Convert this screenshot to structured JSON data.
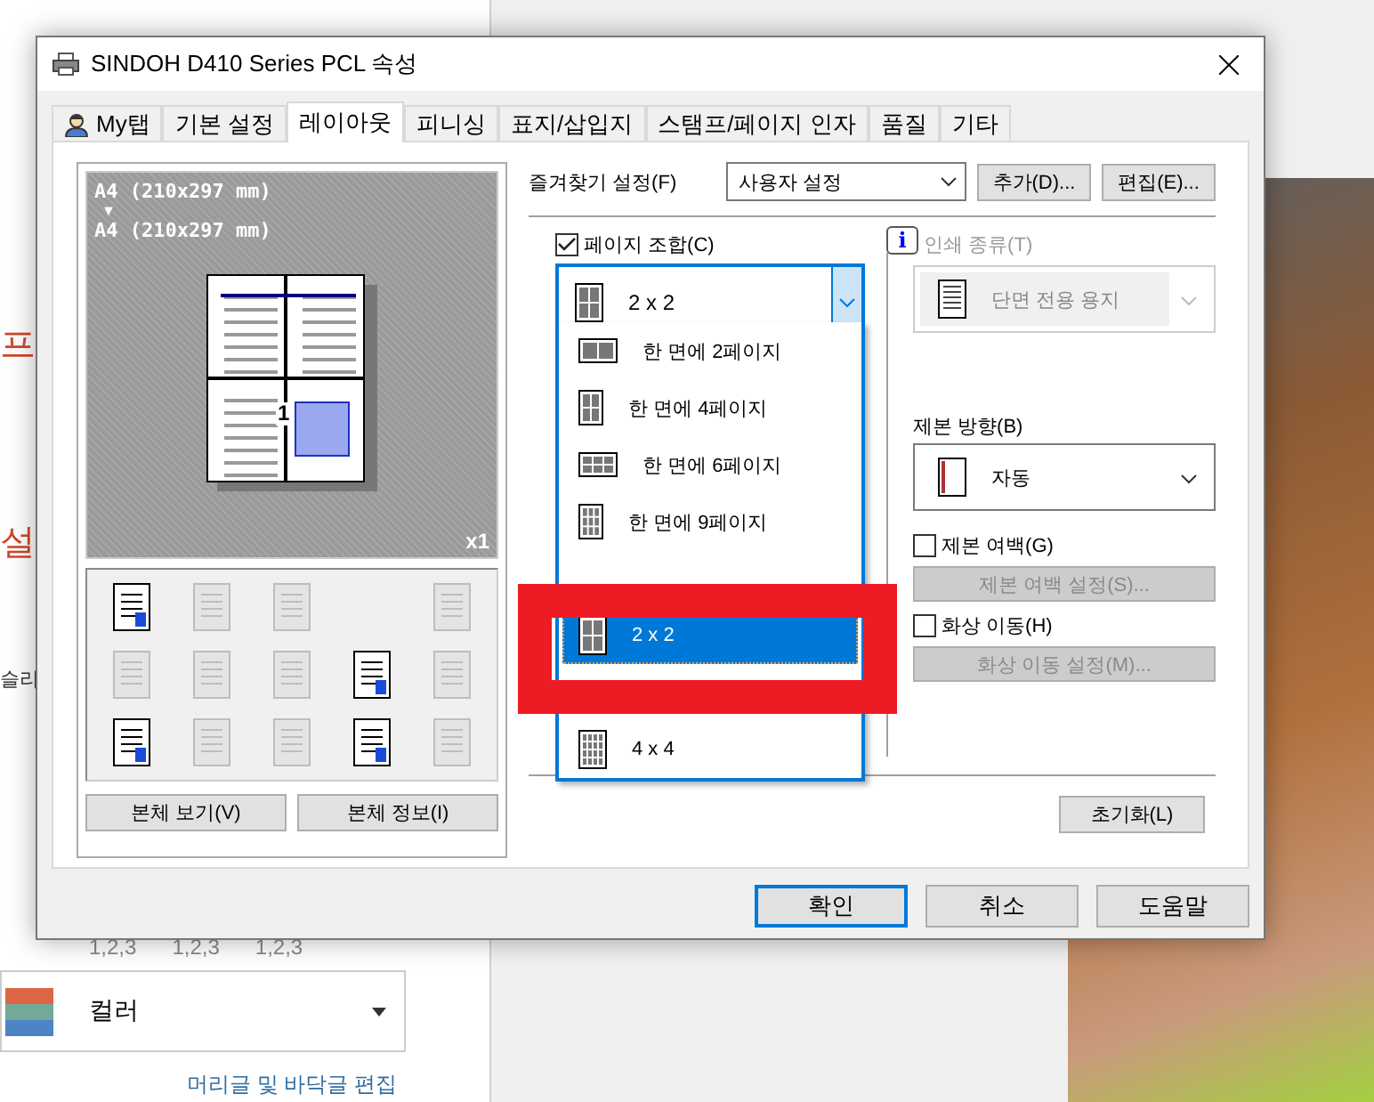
{
  "background_app": {
    "side_labels": [
      "프",
      "설",
      "슬리"
    ],
    "copies": [
      "1,2,3",
      "1,2,3",
      "1,2,3"
    ],
    "color_mode": {
      "label": "컬러"
    },
    "link": "머리글 및 바닥글 편집"
  },
  "window": {
    "title": "SINDOH D410 Series PCL 속성"
  },
  "tabs": [
    {
      "label": "My탭",
      "kind": "person",
      "selected": false
    },
    {
      "label": "기본 설정",
      "kind": "plain",
      "selected": false
    },
    {
      "label": "레이아웃",
      "kind": "plain",
      "selected": true
    },
    {
      "label": "피니싱",
      "kind": "plain",
      "selected": false
    },
    {
      "label": "표지/삽입지",
      "kind": "plain",
      "selected": false
    },
    {
      "label": "스탬프/페이지 인자",
      "kind": "plain",
      "selected": false
    },
    {
      "label": "품질",
      "kind": "plain",
      "selected": false
    },
    {
      "label": "기타",
      "kind": "plain",
      "selected": false
    }
  ],
  "preview": {
    "source_size": "A4 (210x297 mm)",
    "arrow": "▼",
    "output_size": "A4 (210x297 mm)",
    "page_number": "1",
    "copies": "x1"
  },
  "tools": [
    {
      "kind": "tool",
      "disabled": false
    },
    {
      "kind": "tool",
      "disabled": true
    },
    {
      "kind": "tool",
      "disabled": true
    },
    {
      "kind": "blank"
    },
    {
      "kind": "tool",
      "disabled": true
    },
    {
      "kind": "tool",
      "disabled": true
    },
    {
      "kind": "tool",
      "disabled": true
    },
    {
      "kind": "tool",
      "disabled": true
    },
    {
      "kind": "tool",
      "disabled": false
    },
    {
      "kind": "tool",
      "disabled": true
    },
    {
      "kind": "tool",
      "disabled": false
    },
    {
      "kind": "tool",
      "disabled": true
    },
    {
      "kind": "tool",
      "disabled": true
    },
    {
      "kind": "tool",
      "disabled": false
    },
    {
      "kind": "tool",
      "disabled": true
    }
  ],
  "preview_buttons": [
    "본체 보기(V)",
    "본체 정보(I)"
  ],
  "favorites": {
    "label": "즐겨찾기 설정(F)",
    "value": "사용자 설정",
    "buttons": [
      "추가(D)...",
      "편집(E)..."
    ]
  },
  "page_combine": {
    "label": "페이지 조합(C)",
    "checked": true,
    "value": "2 x 2",
    "expanded": true,
    "options": [
      {
        "kind": "n2",
        "label": "한 면에 2페이지",
        "selected": false
      },
      {
        "kind": "n4",
        "label": "한 면에 4페이지",
        "selected": false
      },
      {
        "kind": "n6",
        "label": "한 면에 6페이지",
        "selected": false
      },
      {
        "kind": "n9",
        "label": "한 면에 9페이지",
        "selected": false
      },
      {
        "kind": "g2",
        "label": "2 x 2",
        "selected": true
      },
      {
        "kind": "g4",
        "label": "4 x 4",
        "selected": false
      }
    ]
  },
  "print_type": {
    "info": "i",
    "label": "인쇄 종류(T)",
    "value": "단면 전용 용지",
    "disabled": true
  },
  "binding": {
    "label": "제본 방향(B)",
    "value": "자동"
  },
  "binding_margin": {
    "label": "제본 여백(G)",
    "checked": false,
    "button": "제본 여백 설정(S)...",
    "button_disabled": true
  },
  "image_shift": {
    "label": "화상 이동(H)",
    "checked": false,
    "button": "화상 이동 설정(M)...",
    "button_disabled": true
  },
  "reset_button": "초기화(L)",
  "footer_buttons": [
    {
      "label": "확인",
      "default": true
    },
    {
      "label": "취소",
      "default": false
    },
    {
      "label": "도움말",
      "default": false
    }
  ]
}
